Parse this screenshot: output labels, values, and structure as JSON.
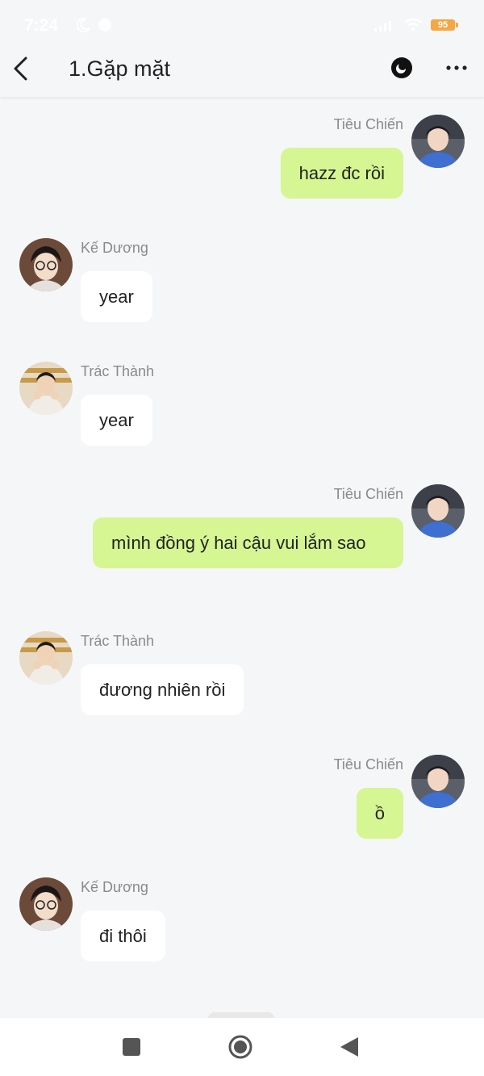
{
  "status_bar": {
    "time": "7:24",
    "battery": "95"
  },
  "header": {
    "title": "1.Gặp mặt"
  },
  "messages": [
    {
      "side": "right",
      "sender": "Tiêu Chiến",
      "text": "hazz đc rồi",
      "avatar": "tieu-chien"
    },
    {
      "side": "left",
      "sender": "Kế Dương",
      "text": "year",
      "avatar": "ke-duong"
    },
    {
      "side": "left",
      "sender": "Trác Thành",
      "text": "year",
      "avatar": "trac-thanh"
    },
    {
      "side": "right",
      "sender": "Tiêu Chiến",
      "text": "mình đồng ý hai cậu vui lắm sao",
      "avatar": "tieu-chien"
    },
    {
      "side": "left",
      "sender": "Trác Thành",
      "text": "đương nhiên rồi",
      "avatar": "trac-thanh"
    },
    {
      "side": "right",
      "sender": "Tiêu Chiến",
      "text": "ồ",
      "avatar": "tieu-chien"
    },
    {
      "side": "left",
      "sender": "Kế Dương",
      "text": "đi thôi",
      "avatar": "ke-duong"
    }
  ],
  "colors": {
    "sent_bubble": "#d5f693",
    "received_bubble": "#ffffff",
    "background": "#f5f6f8",
    "sender_name": "#8a8a8a"
  },
  "icons": {
    "back": "chevron-left-icon",
    "eye": "eye-icon",
    "more": "more-horizontal-icon",
    "nav_recents": "square-icon",
    "nav_home": "circle-icon",
    "nav_back": "triangle-back-icon"
  }
}
